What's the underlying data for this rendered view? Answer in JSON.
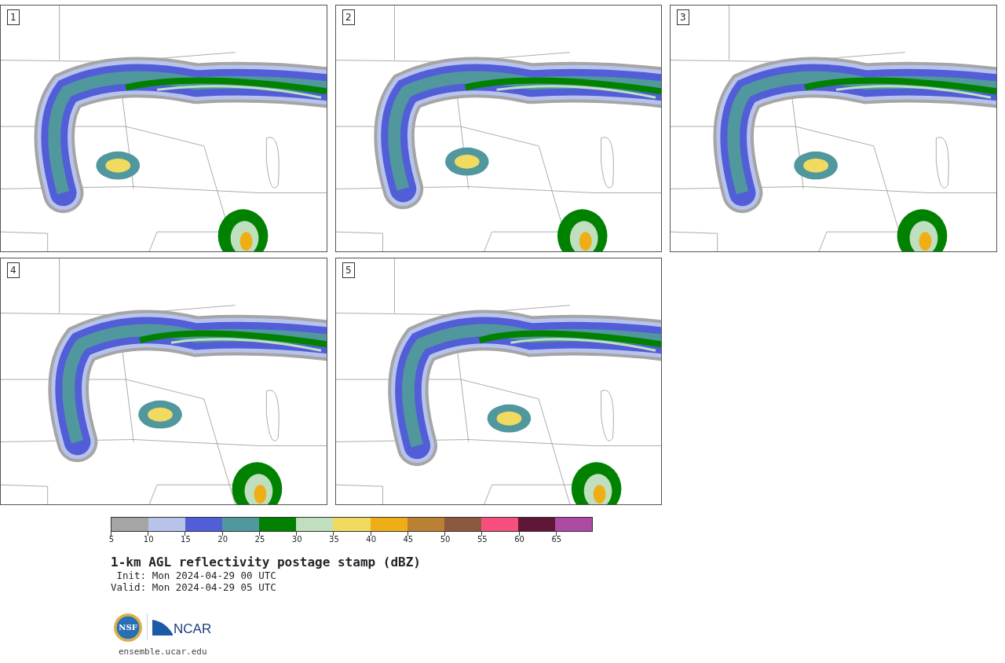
{
  "panels": [
    {
      "label": "1"
    },
    {
      "label": "2"
    },
    {
      "label": "3"
    },
    {
      "label": "4"
    },
    {
      "label": "5"
    }
  ],
  "colorbar": {
    "bins": [
      {
        "color": "#a5a5a5"
      },
      {
        "color": "#b8c3ec"
      },
      {
        "color": "#525dd8"
      },
      {
        "color": "#51979e"
      },
      {
        "color": "#008200"
      },
      {
        "color": "#bfdfbf"
      },
      {
        "color": "#f0da60"
      },
      {
        "color": "#f0ae16"
      },
      {
        "color": "#b98131"
      },
      {
        "color": "#8b5a3e"
      },
      {
        "color": "#f64f7d"
      },
      {
        "color": "#601737"
      },
      {
        "color": "#ad4aa4"
      }
    ],
    "ticks": [
      "5",
      "10",
      "15",
      "20",
      "25",
      "30",
      "35",
      "40",
      "45",
      "50",
      "55",
      "60",
      "65"
    ]
  },
  "title": "1-km AGL reflectivity postage stamp (dBZ)",
  "init": "Init: Mon 2024-04-29 00 UTC",
  "valid": "Valid: Mon 2024-04-29 05 UTC",
  "logos": [
    {
      "text": "NSF"
    },
    {
      "text": "NCAR"
    }
  ],
  "footer": "ensemble.ucar.edu"
}
